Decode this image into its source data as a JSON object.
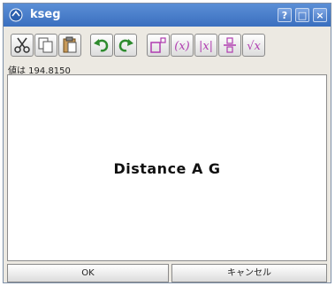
{
  "window": {
    "title": "kseg"
  },
  "titlebar_buttons": {
    "help": "?",
    "maximize": "□",
    "close": "×"
  },
  "toolbar": {
    "items": [
      {
        "name": "cut",
        "icon": "scissors-icon"
      },
      {
        "name": "copy",
        "icon": "copy-icon"
      },
      {
        "name": "paste",
        "icon": "paste-icon"
      },
      {
        "name": "undo",
        "icon": "undo-icon"
      },
      {
        "name": "redo",
        "icon": "redo-icon"
      },
      {
        "name": "exponent",
        "icon": "exponent-icon"
      },
      {
        "name": "parentheses",
        "icon": "parentheses-icon",
        "label": "(x)"
      },
      {
        "name": "absolute-value",
        "icon": "absolute-value-icon",
        "label": "|x|"
      },
      {
        "name": "fraction",
        "icon": "fraction-icon"
      },
      {
        "name": "square-root",
        "icon": "sqrt-icon",
        "label": "√x"
      }
    ]
  },
  "value_readout": "値は 194.8150",
  "canvas": {
    "expression": "Distance A G"
  },
  "buttons": {
    "ok": "OK",
    "cancel": "キャンセル"
  },
  "colors": {
    "titlebar": "#4a80cc",
    "accent_purple": "#b03cb0",
    "arrow_green": "#2e8b2e"
  }
}
